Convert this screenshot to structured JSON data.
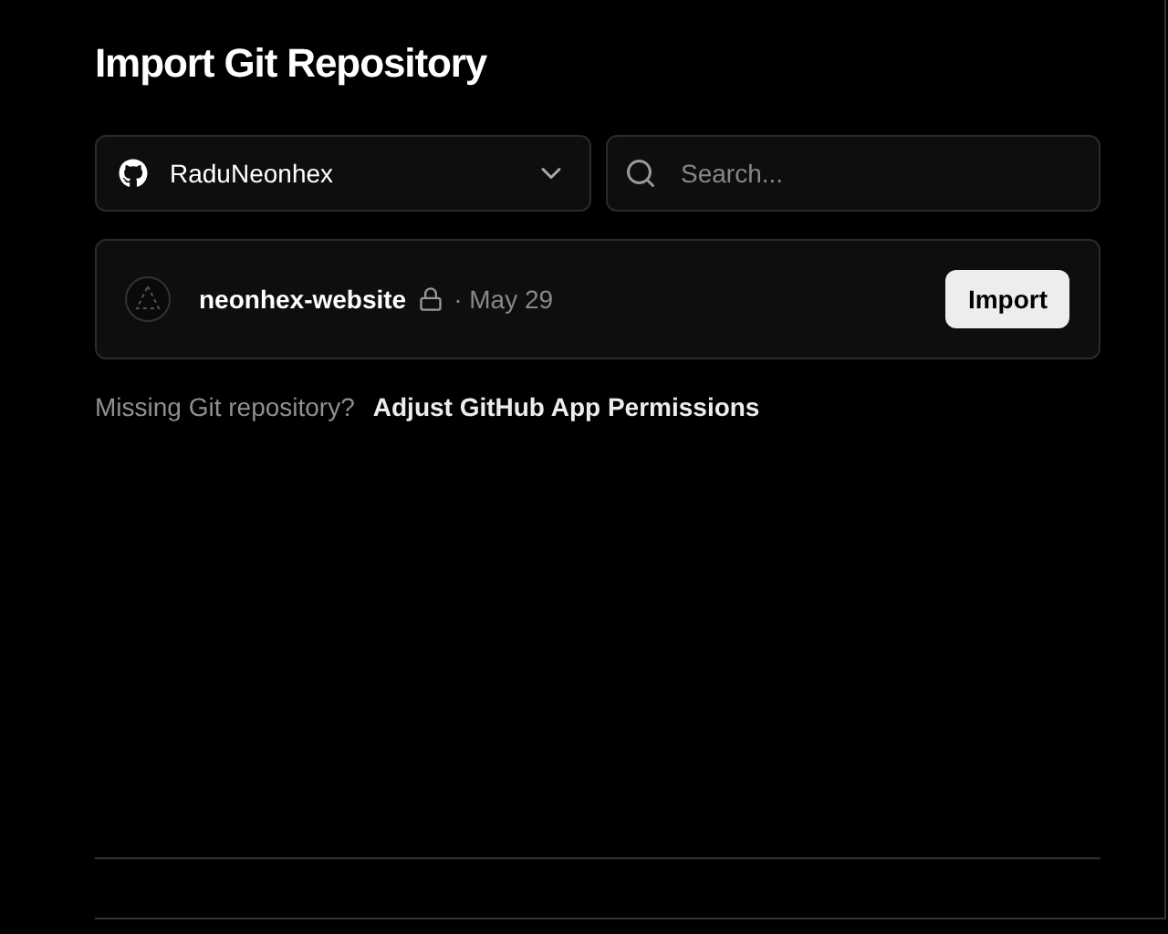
{
  "title": "Import Git Repository",
  "account_select": {
    "value": "RaduNeonhex"
  },
  "search": {
    "placeholder": "Search..."
  },
  "repositories": [
    {
      "name": "neonhex-website",
      "private": true,
      "date": "· May 29",
      "action": "Import"
    }
  ],
  "footer_note": {
    "text": "Missing Git repository?",
    "link": "Adjust GitHub App Permissions"
  }
}
